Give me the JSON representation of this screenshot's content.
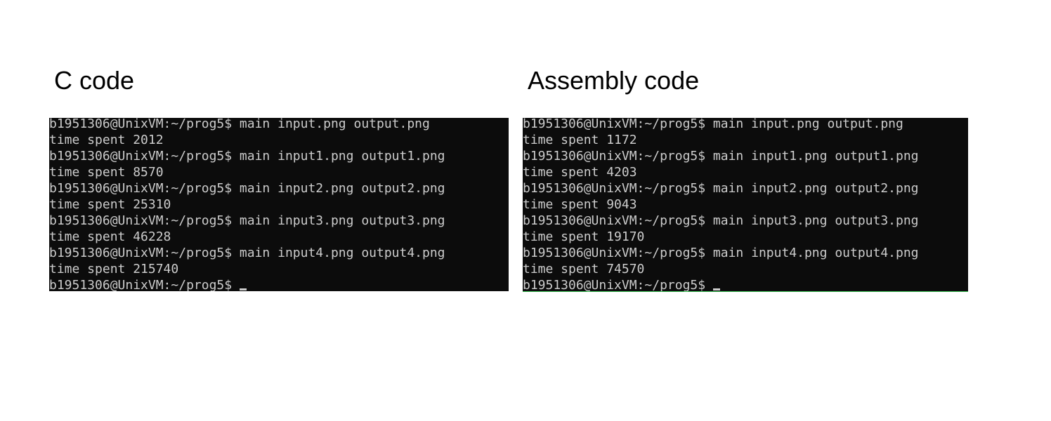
{
  "panels": [
    {
      "heading": "C code",
      "lines": [
        "b1951306@UnixVM:~/prog5$ main input.png output.png",
        "time spent 2012",
        "b1951306@UnixVM:~/prog5$ main input1.png output1.png",
        "time spent 8570",
        "b1951306@UnixVM:~/prog5$ main input2.png output2.png",
        "time spent 25310",
        "b1951306@UnixVM:~/prog5$ main input3.png output3.png",
        "time spent 46228",
        "b1951306@UnixVM:~/prog5$ main input4.png output4.png",
        "time spent 215740",
        "b1951306@UnixVM:~/prog5$"
      ]
    },
    {
      "heading": "Assembly code",
      "lines": [
        "b1951306@UnixVM:~/prog5$ main input.png output.png",
        "time spent 1172",
        "b1951306@UnixVM:~/prog5$ main input1.png output1.png",
        "time spent 4203",
        "b1951306@UnixVM:~/prog5$ main input2.png output2.png",
        "time spent 9043",
        "b1951306@UnixVM:~/prog5$ main input3.png output3.png",
        "time spent 19170",
        "b1951306@UnixVM:~/prog5$ main input4.png output4.png",
        "time spent 74570",
        "b1951306@UnixVM:~/prog5$"
      ]
    }
  ],
  "colors": {
    "terminal_bg": "#0c0c0c",
    "terminal_fg": "#cccccc",
    "page_bg": "#ffffff"
  }
}
